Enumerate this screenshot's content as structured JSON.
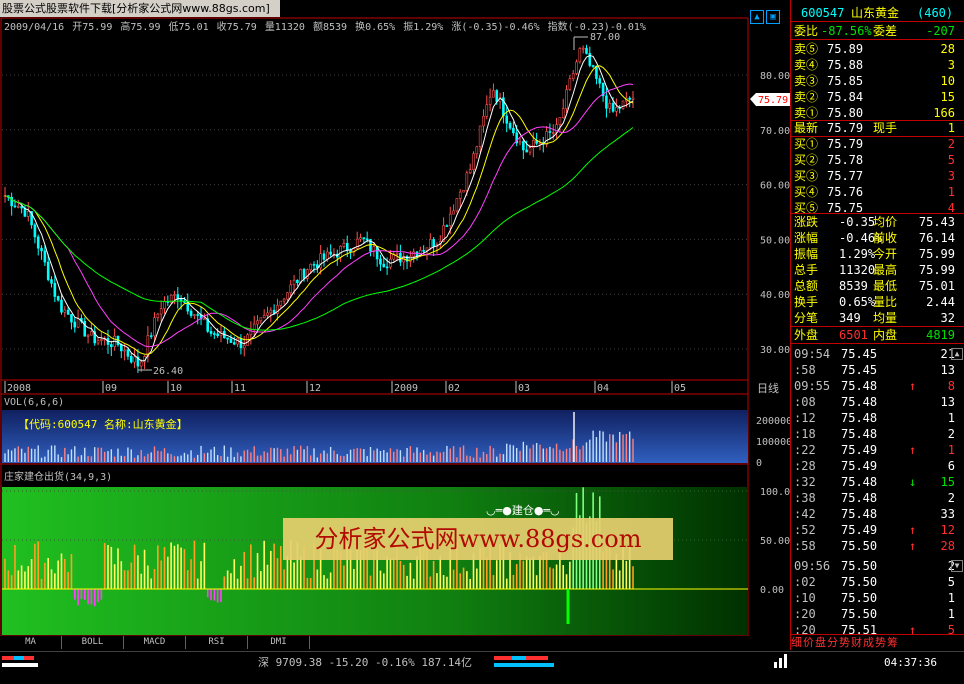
{
  "window": {
    "title": "股票公式股票软件下载[分析家公式网www.88gs.com]"
  },
  "infobar": {
    "date": "2009/04/16",
    "open": "开75.99",
    "high": "高75.99",
    "low": "低75.01",
    "close": "收75.79",
    "vol": "量11320",
    "amount": "额8539",
    "turnover": "换0.65%",
    "amplitude": "振1.29%",
    "change": "涨(-0.35)-0.46%",
    "index": "指数(-0.23)-0.01%"
  },
  "chart": {
    "price_labels": [
      "80.00",
      "70.00",
      "60.00",
      "50.00",
      "40.00",
      "30.00"
    ],
    "high_marker": "87.00",
    "low_marker": "26.40",
    "current_price": "75.79",
    "date_labels": [
      "2008",
      "09",
      "10",
      "11",
      "12",
      "2009",
      "02",
      "03",
      "04",
      "05"
    ],
    "corner_label": "日线",
    "vol_title": "VOL(6,6,6)",
    "vol_labels": [
      "200000",
      "100000",
      "0"
    ],
    "ind_title": "庄家建仓出货(34,9,3)",
    "ind_labels": [
      "100.00",
      "50.00",
      "0.00"
    ],
    "jiancang_label": "建仓",
    "stock_box": "【代码:600547 名称:山东黄金】",
    "watermark": "分析家公式网www.88gs.com"
  },
  "tabs": [
    "MA",
    "BOLL",
    "MACD",
    "RSI",
    "DMI"
  ],
  "bottom": {
    "index_text": "深 9709.38 -15.20 -0.16% 187.14亿",
    "clock": "04:37:36"
  },
  "right": {
    "code": "600547",
    "name": "山东黄金",
    "badge": "(460)",
    "weibi": {
      "label": "委比",
      "value": "-87.56%",
      "label2": "委差",
      "value2": "-207"
    },
    "sells": [
      {
        "label": "卖⑤",
        "price": "75.89",
        "vol": "28"
      },
      {
        "label": "卖④",
        "price": "75.88",
        "vol": "3"
      },
      {
        "label": "卖③",
        "price": "75.85",
        "vol": "10"
      },
      {
        "label": "卖②",
        "price": "75.84",
        "vol": "15"
      },
      {
        "label": "卖①",
        "price": "75.80",
        "vol": "166"
      }
    ],
    "latest": {
      "label": "最新",
      "price": "75.79",
      "label2": "现手",
      "vol": "1"
    },
    "buys": [
      {
        "label": "买①",
        "price": "75.79",
        "vol": "2"
      },
      {
        "label": "买②",
        "price": "75.78",
        "vol": "5"
      },
      {
        "label": "买③",
        "price": "75.77",
        "vol": "3"
      },
      {
        "label": "买④",
        "price": "75.76",
        "vol": "1"
      },
      {
        "label": "买⑤",
        "price": "75.75",
        "vol": "4"
      }
    ],
    "stats": [
      {
        "l1": "涨跌",
        "v1": "-0.35",
        "l2": "均价",
        "v2": "75.43"
      },
      {
        "l1": "涨幅",
        "v1": "-0.46%",
        "l2": "前收",
        "v2": "76.14"
      },
      {
        "l1": "振幅",
        "v1": "1.29%",
        "l2": "今开",
        "v2": "75.99"
      },
      {
        "l1": "总手",
        "v1": "11320",
        "l2": "最高",
        "v2": "75.99"
      },
      {
        "l1": "总额",
        "v1": "8539",
        "l2": "最低",
        "v2": "75.01"
      },
      {
        "l1": "换手",
        "v1": "0.65%",
        "l2": "量比",
        "v2": "2.44"
      },
      {
        "l1": "分笔",
        "v1": "349",
        "l2": "均量",
        "v2": "32"
      }
    ],
    "outer": {
      "label": "外盘",
      "value": "6501",
      "label2": "内盘",
      "value2": "4819"
    },
    "ticks": [
      {
        "t": "09:54",
        "p": "75.45",
        "v": "21",
        "a": ""
      },
      {
        "t": ":58",
        "p": "75.45",
        "v": "13",
        "a": ""
      },
      {
        "t": "09:55",
        "p": "75.48",
        "v": "8",
        "a": "↑"
      },
      {
        "t": ":08",
        "p": "75.48",
        "v": "13",
        "a": ""
      },
      {
        "t": ":12",
        "p": "75.48",
        "v": "1",
        "a": ""
      },
      {
        "t": ":18",
        "p": "75.48",
        "v": "2",
        "a": ""
      },
      {
        "t": ":22",
        "p": "75.49",
        "v": "1",
        "a": "↑"
      },
      {
        "t": ":28",
        "p": "75.49",
        "v": "6",
        "a": ""
      },
      {
        "t": ":32",
        "p": "75.48",
        "v": "15",
        "a": "↓"
      },
      {
        "t": ":38",
        "p": "75.48",
        "v": "2",
        "a": ""
      },
      {
        "t": ":42",
        "p": "75.48",
        "v": "33",
        "a": ""
      },
      {
        "t": ":52",
        "p": "75.49",
        "v": "12",
        "a": "↑"
      },
      {
        "t": ":58",
        "p": "75.50",
        "v": "28",
        "a": "↑"
      },
      {
        "t": "09:56",
        "p": "75.50",
        "v": "2",
        "a": ""
      },
      {
        "t": ":02",
        "p": "75.50",
        "v": "5",
        "a": ""
      },
      {
        "t": ":10",
        "p": "75.50",
        "v": "1",
        "a": ""
      },
      {
        "t": ":20",
        "p": "75.50",
        "v": "1",
        "a": ""
      },
      {
        "t": ":20",
        "p": "75.51",
        "v": "5",
        "a": "↑"
      }
    ],
    "bottom_tabs": "细价盘分势财成势筹"
  }
}
